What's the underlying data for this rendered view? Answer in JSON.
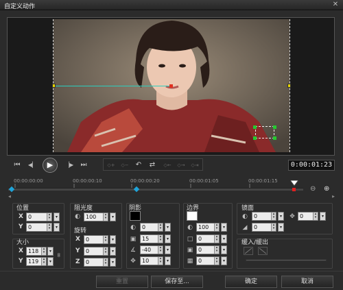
{
  "window": {
    "title": "自定义动作",
    "close_glyph": "✕"
  },
  "playback": {
    "home_glyph": "⏮",
    "prev_glyph": "◀▏",
    "play_glyph": "▶",
    "next_glyph": "▕▶",
    "end_glyph": "⏭",
    "timecode": "0:00:01:23"
  },
  "edit_tools": {
    "glyphs": [
      "◇+",
      "◇−",
      "↶",
      "⇄",
      "◇←",
      "◇→",
      "◇⇥"
    ]
  },
  "timeline": {
    "ticks": [
      "00:00:00:00",
      "00:00:00:10",
      "00:00:00:20",
      "00:00:01:05",
      "00:00:01:15"
    ],
    "zoom_out_glyph": "⊖",
    "zoom_in_glyph": "⊕"
  },
  "position": {
    "label": "位置",
    "x_label": "X",
    "x_value": "0",
    "y_label": "Y",
    "y_value": "0"
  },
  "size": {
    "label": "大小",
    "x_label": "X",
    "x_value": "118",
    "y_label": "Y",
    "y_value": "119",
    "link_glyph": "∞"
  },
  "opacity": {
    "label": "阻光度",
    "value": "100"
  },
  "rotation": {
    "label": "旋转",
    "x_label": "X",
    "x_value": "0",
    "y_label": "Y",
    "y_value": "0",
    "z_label": "Z",
    "z_value": "0"
  },
  "shadow": {
    "label": "阴影",
    "color": "#000000",
    "opacity_value": "0",
    "blur_value": "15",
    "angle_value": "-40",
    "distance_value": "10"
  },
  "border": {
    "label": "边界",
    "color": "#ffffff",
    "opacity_value": "100",
    "width_value": "0",
    "val3": "0",
    "val4": "0"
  },
  "mirror": {
    "label": "镜面",
    "opacity_value": "0",
    "offset_value": "0",
    "move_value": "0"
  },
  "fade": {
    "label": "缓入/缓出"
  },
  "buttons": {
    "reset": "重置",
    "save_to": "保存至...",
    "ok": "确定",
    "cancel": "取消"
  }
}
